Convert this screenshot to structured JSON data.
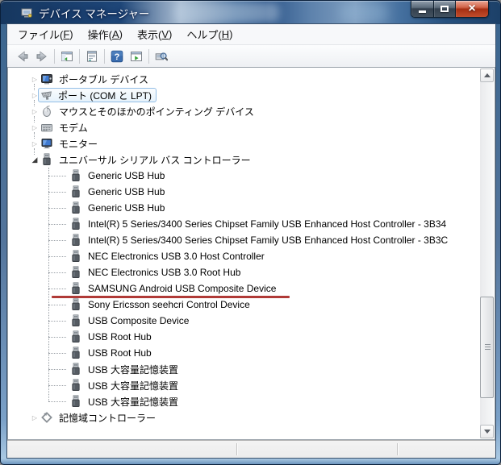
{
  "window": {
    "title": "デバイス マネージャー",
    "controls": {
      "minimize": "minimize",
      "maximize": "maximize",
      "close_glyph": "×"
    }
  },
  "menu": {
    "items": [
      {
        "pre": "ファイル(",
        "key": "F",
        "post": ")"
      },
      {
        "pre": "操作(",
        "key": "A",
        "post": ")"
      },
      {
        "pre": "表示(",
        "key": "V",
        "post": ")"
      },
      {
        "pre": "ヘルプ(",
        "key": "H",
        "post": ")"
      }
    ]
  },
  "toolbar": {
    "icons": [
      "back-icon",
      "forward-icon",
      "console-tree-icon",
      "properties-icon",
      "help-icon",
      "action-pane-icon",
      "scan-hardware-icon"
    ]
  },
  "tree": {
    "collapsed_glyph": "▷",
    "expanded_glyph": "◢",
    "items": [
      {
        "label": "ポータブル デバイス",
        "level": 0,
        "state": "collapsed",
        "icon": "portable-device",
        "selected": false,
        "underlined": false
      },
      {
        "label": "ポート (COM と LPT)",
        "level": 0,
        "state": "collapsed",
        "icon": "serial-port",
        "selected": true,
        "underlined": false
      },
      {
        "label": "マウスとそのほかのポインティング デバイス",
        "level": 0,
        "state": "collapsed",
        "icon": "mouse",
        "selected": false,
        "underlined": false
      },
      {
        "label": "モデム",
        "level": 0,
        "state": "collapsed",
        "icon": "modem",
        "selected": false,
        "underlined": false
      },
      {
        "label": "モニター",
        "level": 0,
        "state": "collapsed",
        "icon": "monitor",
        "selected": false,
        "underlined": false
      },
      {
        "label": "ユニバーサル シリアル バス コントローラー",
        "level": 0,
        "state": "expanded",
        "icon": "usb",
        "selected": false,
        "underlined": false
      },
      {
        "label": "Generic USB Hub",
        "level": 1,
        "icon": "usb",
        "selected": false,
        "underlined": false
      },
      {
        "label": "Generic USB Hub",
        "level": 1,
        "icon": "usb",
        "selected": false,
        "underlined": false
      },
      {
        "label": "Generic USB Hub",
        "level": 1,
        "icon": "usb",
        "selected": false,
        "underlined": false
      },
      {
        "label": "Intel(R) 5 Series/3400 Series Chipset Family USB Enhanced Host Controller - 3B34",
        "level": 1,
        "icon": "usb",
        "selected": false,
        "underlined": false
      },
      {
        "label": "Intel(R) 5 Series/3400 Series Chipset Family USB Enhanced Host Controller - 3B3C",
        "level": 1,
        "icon": "usb",
        "selected": false,
        "underlined": false
      },
      {
        "label": "NEC Electronics USB 3.0 Host Controller",
        "level": 1,
        "icon": "usb",
        "selected": false,
        "underlined": false
      },
      {
        "label": "NEC Electronics USB 3.0 Root Hub",
        "level": 1,
        "icon": "usb",
        "selected": false,
        "underlined": false
      },
      {
        "label": "SAMSUNG Android USB Composite Device",
        "level": 1,
        "icon": "usb",
        "selected": false,
        "underlined": true
      },
      {
        "label": "Sony Ericsson seehcri Control Device",
        "level": 1,
        "icon": "usb",
        "selected": false,
        "underlined": false
      },
      {
        "label": "USB Composite Device",
        "level": 1,
        "icon": "usb",
        "selected": false,
        "underlined": false
      },
      {
        "label": "USB Root Hub",
        "level": 1,
        "icon": "usb",
        "selected": false,
        "underlined": false
      },
      {
        "label": "USB Root Hub",
        "level": 1,
        "icon": "usb",
        "selected": false,
        "underlined": false
      },
      {
        "label": "USB 大容量記憶装置",
        "level": 1,
        "icon": "usb",
        "selected": false,
        "underlined": false
      },
      {
        "label": "USB 大容量記憶装置",
        "level": 1,
        "icon": "usb",
        "selected": false,
        "underlined": false
      },
      {
        "label": "USB 大容量記憶装置",
        "level": 1,
        "icon": "usb",
        "selected": false,
        "underlined": false
      },
      {
        "label": "記憶域コントローラー",
        "level": 0,
        "state": "collapsed",
        "icon": "storage-controller",
        "selected": false,
        "underlined": false
      }
    ]
  },
  "statusbar": {
    "panels": [
      "",
      "",
      ""
    ]
  },
  "colors": {
    "annotation_underline_red": "#b03a37",
    "selection_border_blue": "#94bee6",
    "help_button_blue": "#3a6db0",
    "titlebar_aero_blue": "#1e4678"
  }
}
